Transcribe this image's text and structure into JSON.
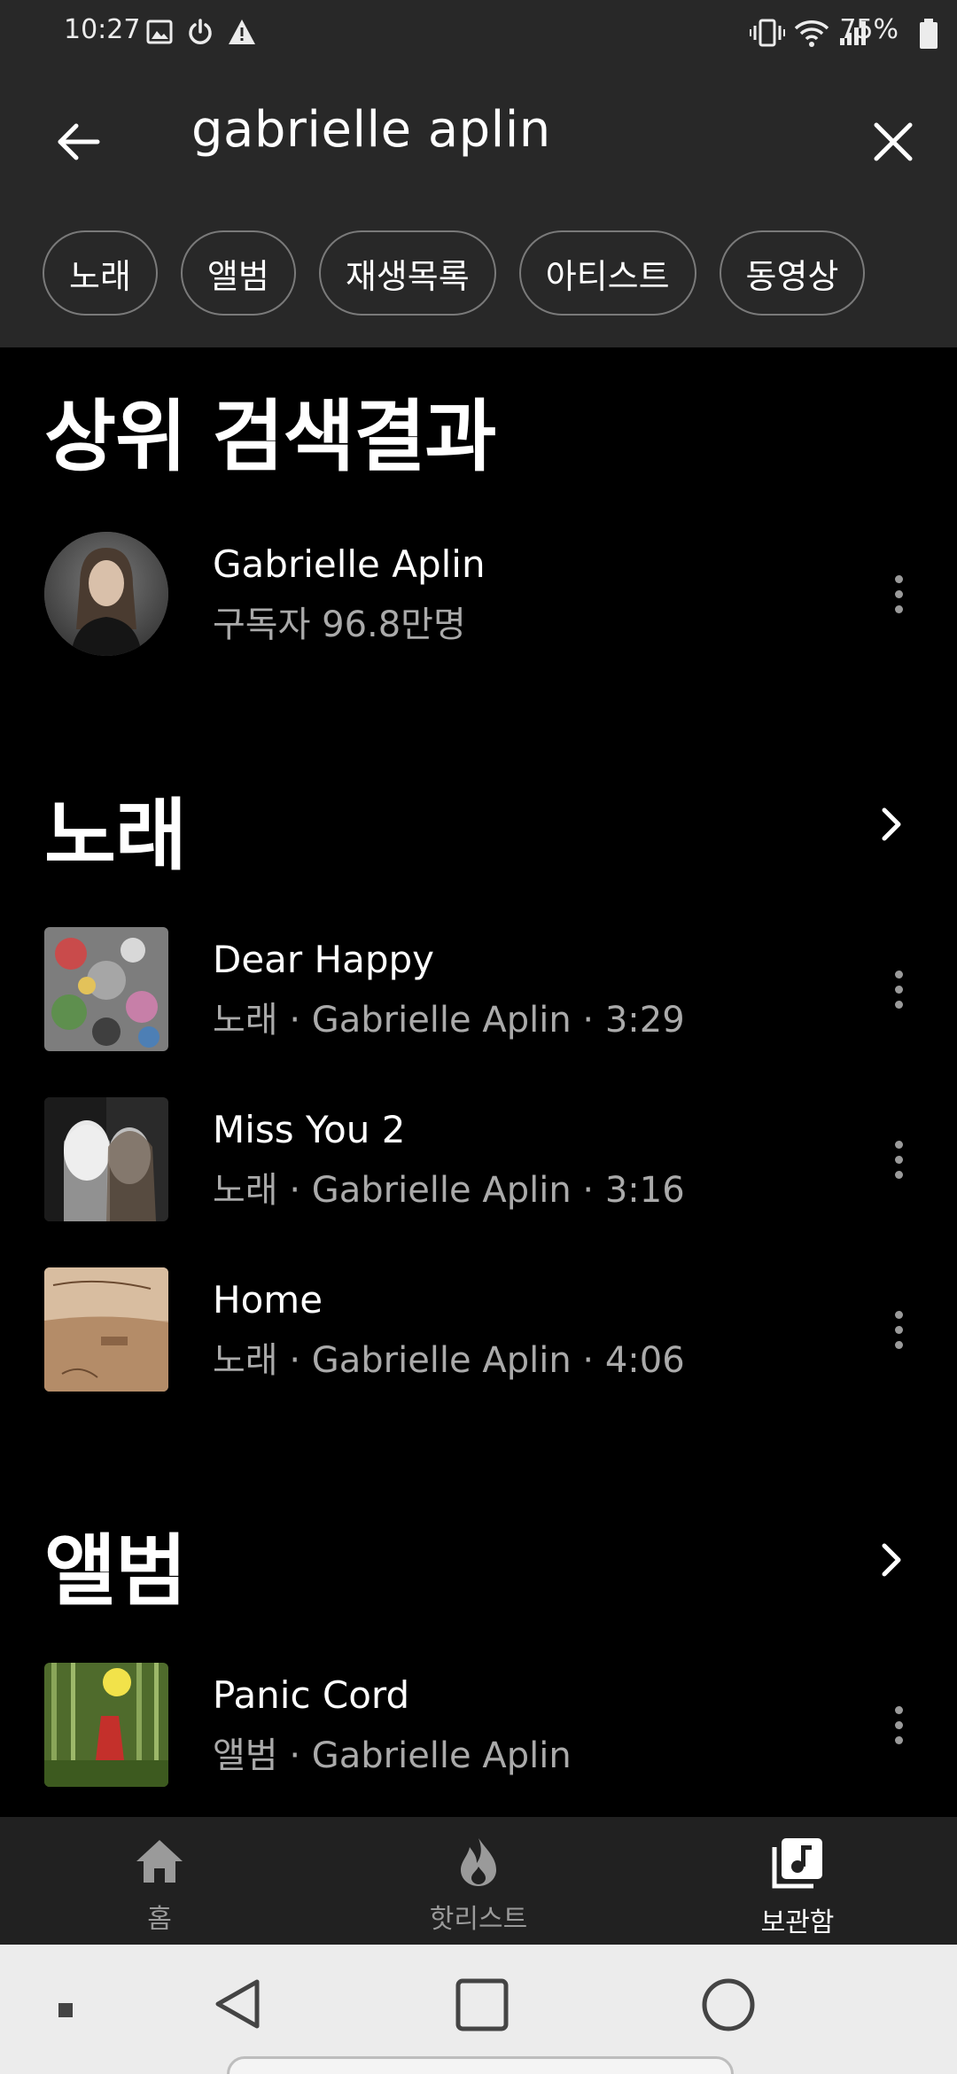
{
  "status_bar": {
    "time": "10:27",
    "battery_percent": "75%",
    "left_icons": [
      "gallery-icon",
      "power-icon",
      "warning-icon"
    ],
    "right_icons": [
      "vibrate-icon",
      "wifi-icon",
      "signal-icon",
      "battery-icon"
    ]
  },
  "search": {
    "query": "gabrielle aplin"
  },
  "filter_chips": [
    "노래",
    "앨범",
    "재생목록",
    "아티스트",
    "동영상"
  ],
  "top_result": {
    "section_title": "상위 검색결과",
    "name": "Gabrielle Aplin",
    "subtitle": "구독자 96.8만명"
  },
  "songs": {
    "section_title": "노래",
    "items": [
      {
        "title": "Dear Happy",
        "subtitle": "노래 · Gabrielle Aplin · 3:29"
      },
      {
        "title": "Miss You 2",
        "subtitle": "노래 · Gabrielle Aplin · 3:16"
      },
      {
        "title": "Home",
        "subtitle": "노래 · Gabrielle Aplin · 4:06"
      }
    ]
  },
  "albums": {
    "section_title": "앨범",
    "items": [
      {
        "title": "Panic Cord",
        "subtitle": "앨범 · Gabrielle Aplin"
      }
    ]
  },
  "bottom_nav": {
    "items": [
      {
        "label": "홈",
        "icon": "home-icon",
        "active": false
      },
      {
        "label": "핫리스트",
        "icon": "flame-icon",
        "active": false
      },
      {
        "label": "보관함",
        "icon": "library-icon",
        "active": true
      }
    ]
  },
  "colors": {
    "header_bg": "#282828",
    "content_bg": "#000000",
    "nav_bg": "#212121",
    "system_nav_bg": "#ececec",
    "secondary_text": "#aaaaaa"
  }
}
